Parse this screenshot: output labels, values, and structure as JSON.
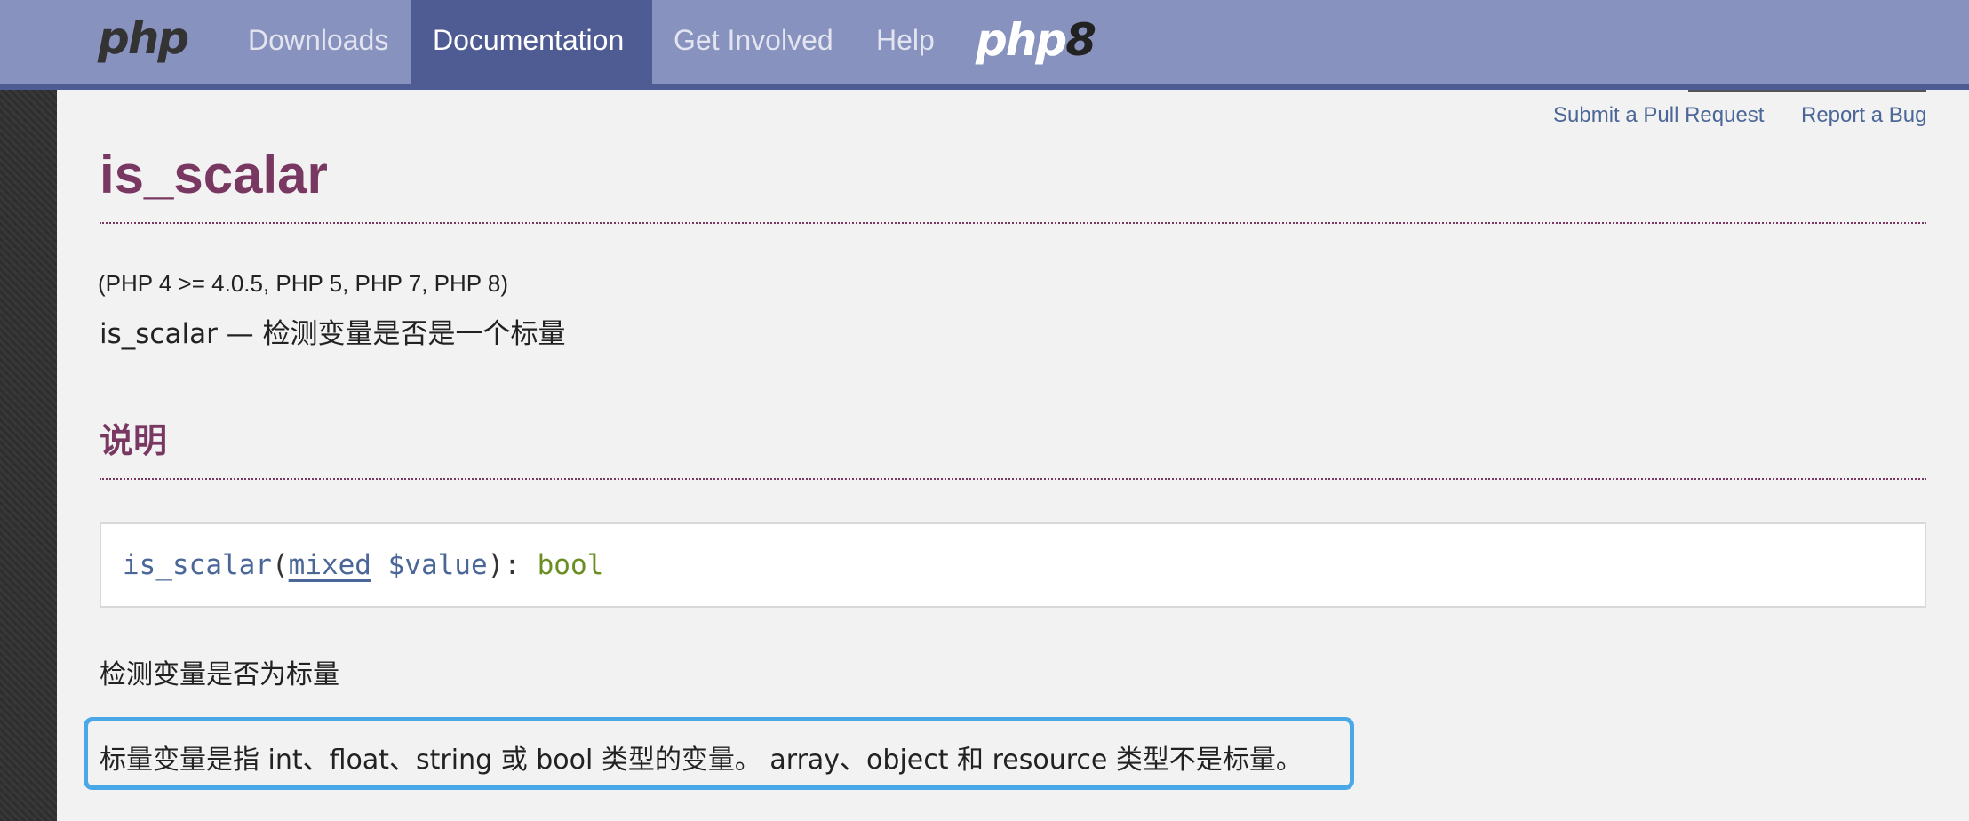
{
  "nav": {
    "logo": "php",
    "items": [
      "Downloads",
      "Documentation",
      "Get Involved",
      "Help"
    ],
    "active": "Documentation",
    "version_logo_text": "php",
    "version_logo_number": "8"
  },
  "top_links": {
    "pull_request": "Submit a Pull Request",
    "report_bug": "Report a Bug"
  },
  "page": {
    "title": "is_scalar",
    "versions": "(PHP 4 >= 4.0.5, PHP 5, PHP 7, PHP 8)",
    "refpurpose": "is_scalar — 检测变量是否是一个标量",
    "section_heading": "说明",
    "synopsis": {
      "function": "is_scalar",
      "open_paren": "(",
      "param_type": "mixed",
      "param_name": "$value",
      "close": "): ",
      "return_type": "bool"
    },
    "para1": "检测变量是否为标量",
    "para2": "标量变量是指 int、float、string 或 bool 类型的变量。 array、object 和 resource 类型不是标量。"
  },
  "colors": {
    "nav_bg": "#8892bf",
    "nav_active": "#4f5b93",
    "title": "#793862",
    "link": "#4b6797",
    "highlight": "#4aa8e8"
  }
}
